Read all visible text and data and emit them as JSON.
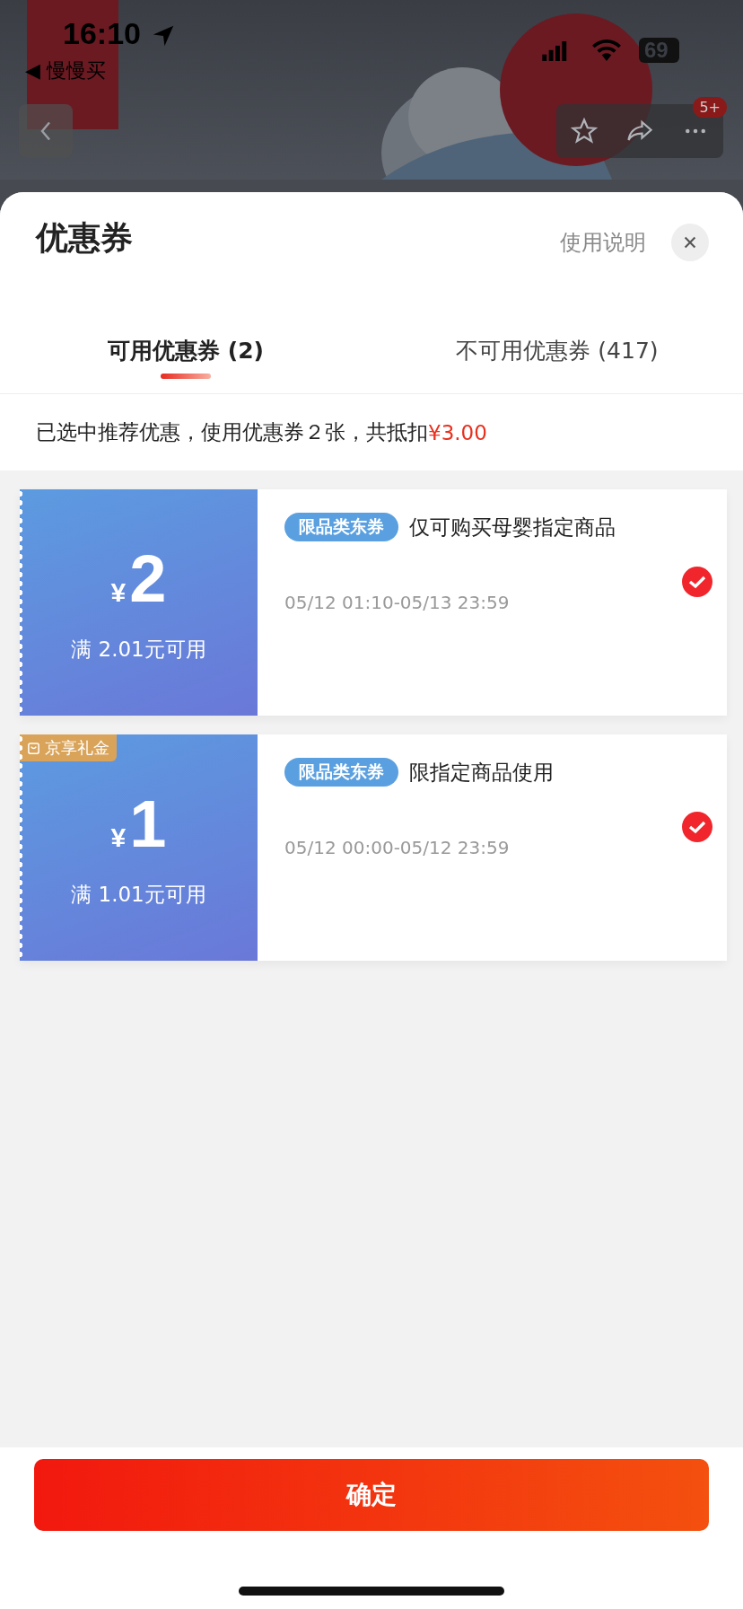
{
  "status_bar": {
    "time": "16:10",
    "back_app": "◀ 慢慢买",
    "battery": "69"
  },
  "nav": {
    "badge": "5+"
  },
  "sheet": {
    "title": "优惠券",
    "help_link": "使用说明"
  },
  "tabs": [
    {
      "label": "可用优惠券 (2)",
      "selected": true
    },
    {
      "label": "不可用优惠券 (417)",
      "selected": false
    }
  ],
  "summary": {
    "text": "已选中推荐优惠，使用优惠券２张，共抵扣",
    "amount": "¥3.00"
  },
  "coupons": [
    {
      "currency": "¥",
      "amount": "2",
      "condition": "满 2.01元可用",
      "tag": "限品类东券",
      "title": "仅可购买母婴指定商品",
      "validity": "05/12 01:10-05/13 23:59",
      "checked": true
    },
    {
      "badge": "京享礼金",
      "currency": "¥",
      "amount": "1",
      "condition": "满 1.01元可用",
      "tag": "限品类东券",
      "title": "限指定商品使用",
      "validity": "05/12 00:00-05/12 23:59",
      "checked": true
    }
  ],
  "confirm_button": "确定"
}
